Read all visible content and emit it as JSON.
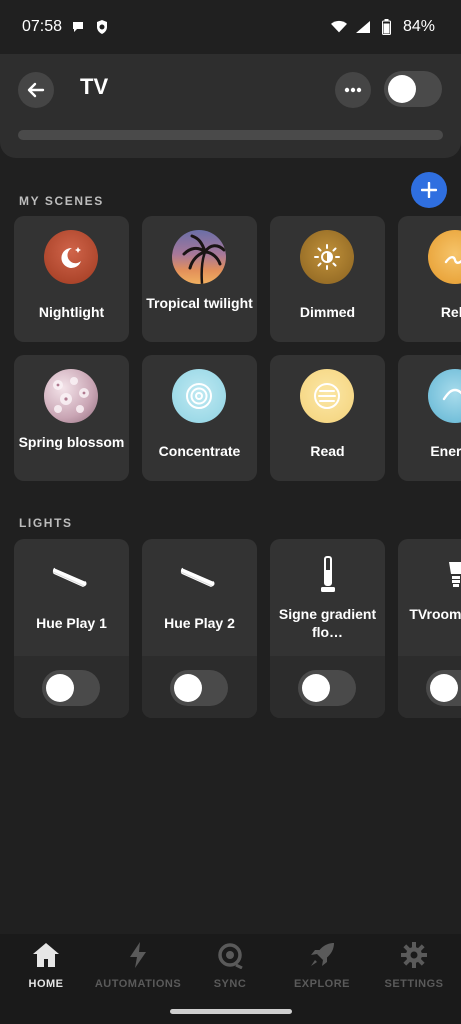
{
  "status_bar": {
    "time": "07:58",
    "battery": "84%"
  },
  "header": {
    "title": "TV"
  },
  "scenes_section": {
    "title": "MY SCENES"
  },
  "scenes": [
    {
      "label": "Nightlight",
      "icon": "moon-stars-icon"
    },
    {
      "label": "Tropical twilight",
      "icon": "palm-sunset-image"
    },
    {
      "label": "Dimmed",
      "icon": "dim-sun-icon"
    },
    {
      "label": "Relax",
      "icon": "relax-icon"
    },
    {
      "label": "Spring blossom",
      "icon": "blossom-image"
    },
    {
      "label": "Concentrate",
      "icon": "concentrate-icon"
    },
    {
      "label": "Read",
      "icon": "read-icon"
    },
    {
      "label": "Energize",
      "icon": "energize-icon"
    }
  ],
  "lights_section": {
    "title": "LIGHTS"
  },
  "lights": [
    {
      "label": "Hue Play 1",
      "icon": "light-bar-icon",
      "on": false
    },
    {
      "label": "Hue Play 2",
      "icon": "light-bar-icon",
      "on": false
    },
    {
      "label": "Signe gradient flo…",
      "icon": "floor-lamp-icon",
      "on": false
    },
    {
      "label": "TVroom tec",
      "icon": "spot-bulb-icon",
      "on": false
    }
  ],
  "nav": [
    {
      "label": "HOME",
      "icon": "home-icon",
      "active": true
    },
    {
      "label": "AUTOMATIONS",
      "icon": "lightning-icon",
      "active": false
    },
    {
      "label": "SYNC",
      "icon": "sync-icon",
      "active": false
    },
    {
      "label": "EXPLORE",
      "icon": "rocket-icon",
      "active": false
    },
    {
      "label": "SETTINGS",
      "icon": "gear-icon",
      "active": false
    }
  ],
  "colors": {
    "background": "#202020",
    "tile": "#333333",
    "accent": "#2f6fe0"
  }
}
